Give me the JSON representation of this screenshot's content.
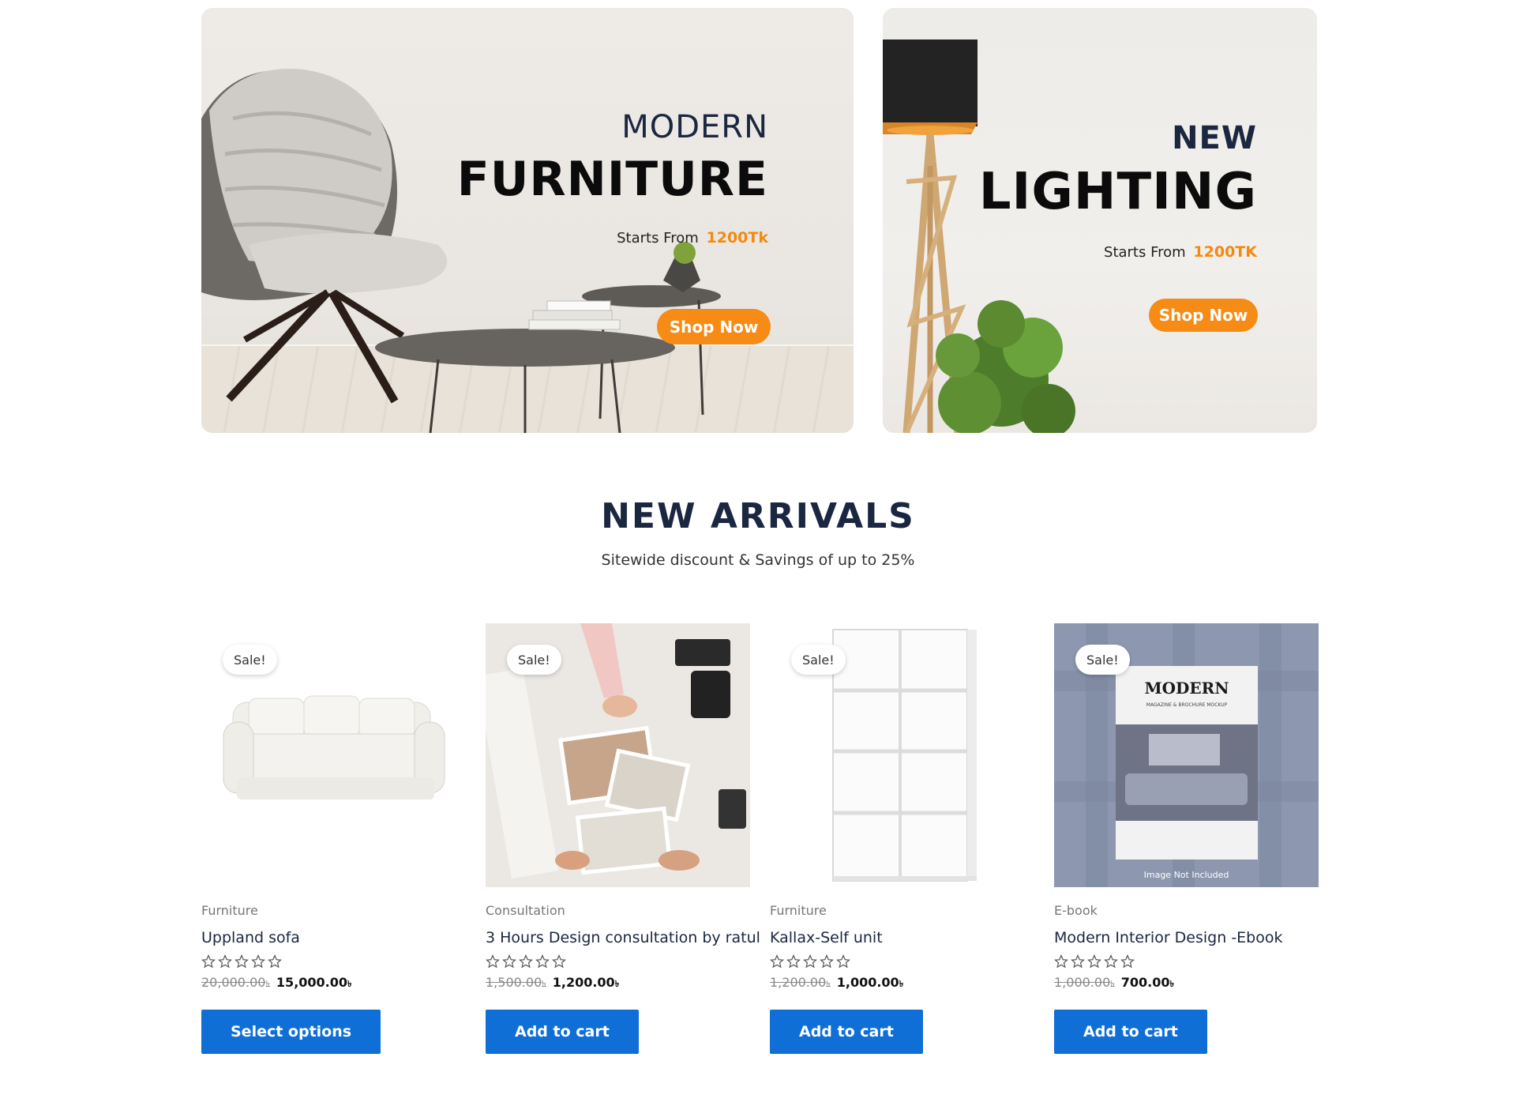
{
  "banners": [
    {
      "kicker": "MODERN",
      "headline": "FURNITURE",
      "price_label": "Starts From",
      "price_amount": "1200Tk",
      "button": "Shop Now"
    },
    {
      "kicker": "NEW",
      "headline": "LIGHTING",
      "price_label": "Starts From",
      "price_amount": "1200TK",
      "button": "Shop Now"
    }
  ],
  "arrivals": {
    "title": "NEW ARRIVALS",
    "subtitle": "Sitewide discount & Savings of up to 25%"
  },
  "products": [
    {
      "badge": "Sale!",
      "category": "Furniture",
      "name": "Uppland sofa",
      "rating": 0,
      "old_price": "20,000.00",
      "new_price": "15,000.00",
      "currency": "৳",
      "button": "Select options"
    },
    {
      "badge": "Sale!",
      "category": "Consultation",
      "name": "3 Hours Design consultation by ratul",
      "rating": 0,
      "old_price": "1,500.00",
      "new_price": "1,200.00",
      "currency": "৳",
      "button": "Add to cart"
    },
    {
      "badge": "Sale!",
      "category": "Furniture",
      "name": "Kallax-Self unit",
      "rating": 0,
      "old_price": "1,200.00",
      "new_price": "1,000.00",
      "currency": "৳",
      "button": "Add to cart"
    },
    {
      "badge": "Sale!",
      "category": "E-book",
      "name": "Modern Interior Design -Ebook",
      "rating": 0,
      "old_price": "1,000.00",
      "new_price": "700.00",
      "currency": "৳",
      "button": "Add to cart"
    }
  ],
  "ebook_cover": {
    "title": "MODERN",
    "subtitle": "MAGAZINE & BROCHURE MOCKUP",
    "note": "Image Not Included"
  },
  "colors": {
    "accent_orange": "#f68b15",
    "button_blue": "#0f6fd6",
    "heading_navy": "#1b2641"
  }
}
